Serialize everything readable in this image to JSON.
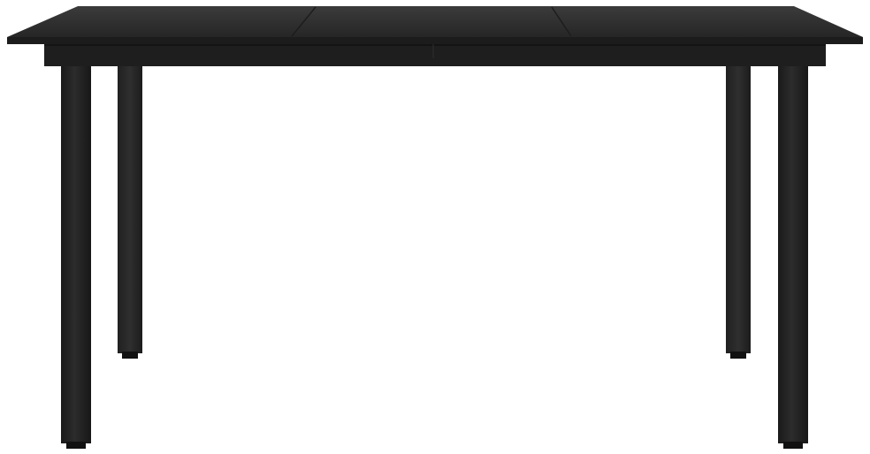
{
  "image": {
    "subject": "table",
    "background_color": "#ffffff",
    "colors": {
      "top_glass": "#2b2b2b",
      "top_glass_highlight": "#3a3a3a",
      "top_edge": "#1c1c1c",
      "apron": "#1e1e1e",
      "leg_front": "#1f1f1f",
      "leg_back": "#252525",
      "leg_shadow": "#111111"
    }
  }
}
